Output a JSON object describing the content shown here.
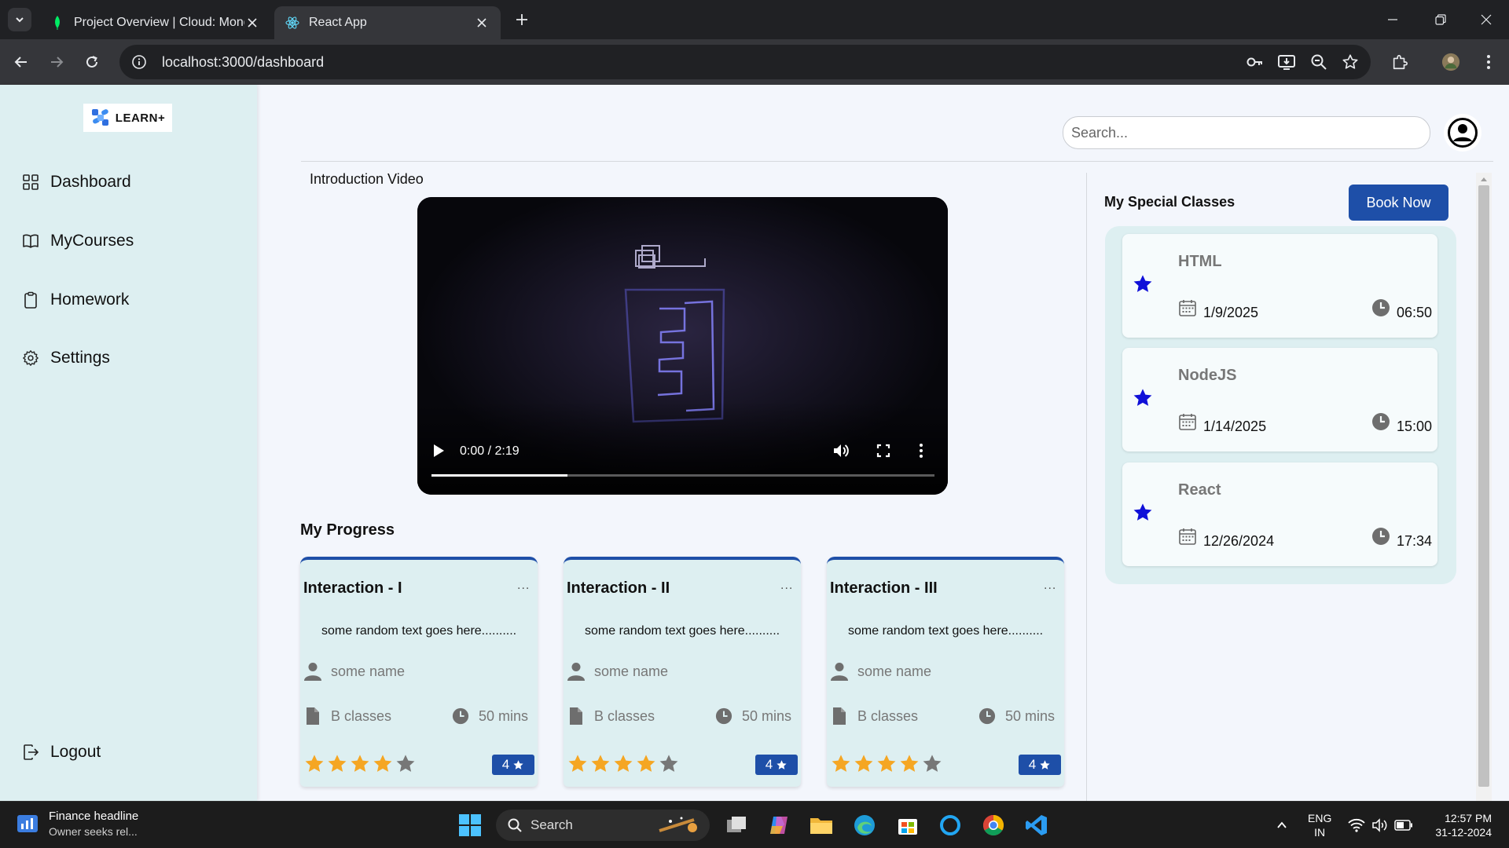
{
  "browser": {
    "tabs": [
      {
        "title": "Project Overview | Cloud: Mong",
        "active": false
      },
      {
        "title": "React App",
        "active": true
      }
    ],
    "url": "localhost:3000/dashboard"
  },
  "sidebar": {
    "logo_text": "LEARN+",
    "nav": [
      {
        "label": "Dashboard",
        "icon": "grid-icon"
      },
      {
        "label": "MyCourses",
        "icon": "book-icon"
      },
      {
        "label": "Homework",
        "icon": "clipboard-icon"
      },
      {
        "label": "Settings",
        "icon": "gear-icon"
      }
    ],
    "logout_label": "Logout"
  },
  "header": {
    "search_placeholder": "Search..."
  },
  "video": {
    "label": "Introduction Video",
    "time": "0:00 / 2:19",
    "buffered_fraction": 0.27
  },
  "progress": {
    "title": "My Progress",
    "cards": [
      {
        "title": "Interaction - I",
        "more": "...",
        "description": "some random text goes here..........",
        "author": "some name",
        "classes": "B classes",
        "duration": "50 mins",
        "rating": 4,
        "badge": "4"
      },
      {
        "title": "Interaction - II",
        "more": "...",
        "description": "some random text goes here..........",
        "author": "some name",
        "classes": "B classes",
        "duration": "50 mins",
        "rating": 4,
        "badge": "4"
      },
      {
        "title": "Interaction - III",
        "more": "...",
        "description": "some random text goes here..........",
        "author": "some name",
        "classes": "B classes",
        "duration": "50 mins",
        "rating": 4,
        "badge": "4"
      }
    ]
  },
  "special_classes": {
    "title": "My Special Classes",
    "book_label": "Book Now",
    "items": [
      {
        "name": "HTML",
        "date": "1/9/2025",
        "time": "06:50"
      },
      {
        "name": "NodeJS",
        "date": "1/14/2025",
        "time": "15:00"
      },
      {
        "name": "React",
        "date": "12/26/2024",
        "time": "17:34"
      }
    ]
  },
  "taskbar": {
    "news_title": "Finance headline",
    "news_subtitle": "Owner seeks rel...",
    "search_label": "Search",
    "lang_line1": "ENG",
    "lang_line2": "IN",
    "time": "12:57 PM",
    "date": "31-12-2024"
  },
  "colors": {
    "accent": "#1e4fa8",
    "sidebar_bg": "#ddeff1",
    "star_gold": "#f5a623",
    "star_blue": "#1010d8"
  }
}
